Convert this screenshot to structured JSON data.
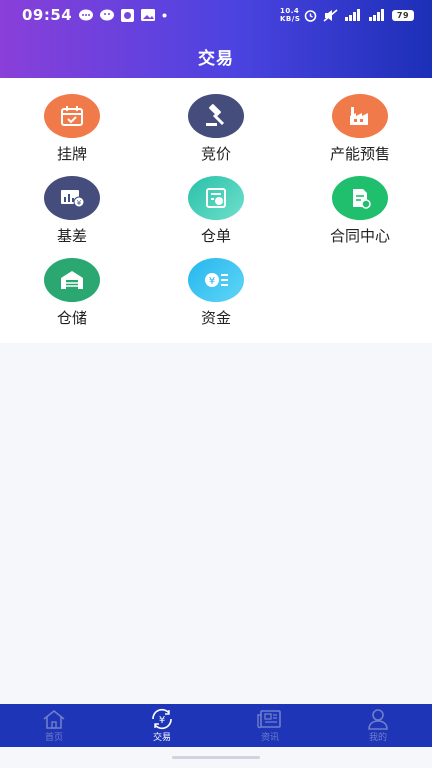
{
  "status_bar": {
    "time": "09:54",
    "speed": "10.4 KB/S",
    "battery": "79"
  },
  "header": {
    "title": "交易"
  },
  "grid": [
    {
      "label": "挂牌",
      "icon": "calendar-check-icon",
      "color": "#f07a4a"
    },
    {
      "label": "竞价",
      "icon": "gavel-icon",
      "color": "#454d7c"
    },
    {
      "label": "产能预售",
      "icon": "factory-icon",
      "color": "#f07a4a"
    },
    {
      "label": "基差",
      "icon": "basis-chart-icon",
      "color": "#454d7c"
    },
    {
      "label": "仓单",
      "icon": "warehouse-receipt-icon",
      "color": "#3cc6b3"
    },
    {
      "label": "合同中心",
      "icon": "contract-icon",
      "color": "#1fbf6e"
    },
    {
      "label": "仓储",
      "icon": "warehouse-icon",
      "color": "#2ba872"
    },
    {
      "label": "资金",
      "icon": "money-icon",
      "color": "#2ec4f0"
    }
  ],
  "bottom_nav": [
    {
      "label": "首页",
      "icon": "home-icon",
      "active": false
    },
    {
      "label": "交易",
      "icon": "yen-exchange-icon",
      "active": true
    },
    {
      "label": "资讯",
      "icon": "news-icon",
      "active": false
    },
    {
      "label": "我的",
      "icon": "user-icon",
      "active": false
    }
  ]
}
